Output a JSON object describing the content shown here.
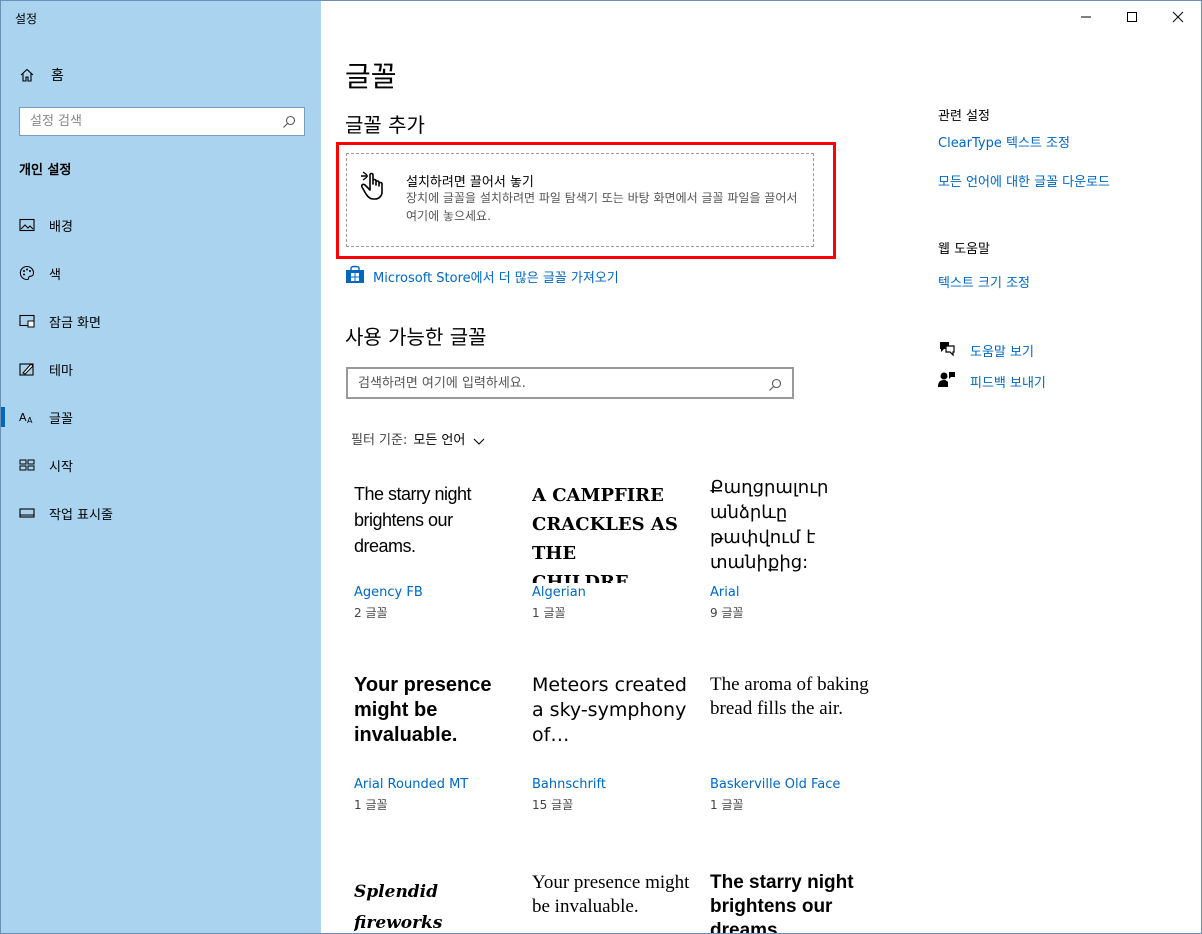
{
  "window": {
    "title": "설정"
  },
  "sidebar": {
    "home_label": "홈",
    "search_placeholder": "설정 검색",
    "section_title": "개인 설정",
    "items": [
      {
        "label": "배경",
        "icon": "image-icon"
      },
      {
        "label": "색",
        "icon": "palette-icon"
      },
      {
        "label": "잠금 화면",
        "icon": "lock-screen-icon"
      },
      {
        "label": "테마",
        "icon": "theme-icon"
      },
      {
        "label": "글꼴",
        "icon": "font-icon",
        "active": true
      },
      {
        "label": "시작",
        "icon": "start-icon"
      },
      {
        "label": "작업 표시줄",
        "icon": "taskbar-icon"
      }
    ]
  },
  "main": {
    "title": "글꼴",
    "add_heading": "글꼴 추가",
    "dropzone": {
      "title": "설치하려면 끌어서 놓기",
      "description": "장치에 글꼴을 설치하려면 파일 탐색기 또는 바탕 화면에서 글꼴 파일을 끌어서 여기에 놓으세요."
    },
    "store_link": "Microsoft Store에서 더 많은 글꼴 가져오기",
    "available_heading": "사용 가능한 글꼴",
    "font_search_placeholder": "검색하려면 여기에 입력하세요.",
    "filter_prefix": "필터 기준:",
    "filter_value": "모든 언어",
    "fonts": [
      {
        "sample": "The starry night brightens our dreams.",
        "name": "Agency FB",
        "count": "2 글꼴"
      },
      {
        "sample": "A CAMPFIRE CRACKLES AS THE CHILDRE…",
        "name": "Algerian",
        "count": "1 글꼴"
      },
      {
        "sample": "Քաղցրալուր անձրևը թափվում է տանիքից:",
        "name": "Arial",
        "count": "9 글꼴"
      },
      {
        "sample": "Your presence might be invaluable.",
        "name": "Arial Rounded MT",
        "count": "1 글꼴"
      },
      {
        "sample": "Meteors created a sky-symphony of…",
        "name": "Bahnschrift",
        "count": "15 글꼴"
      },
      {
        "sample": "The aroma of baking bread fills the air.",
        "name": "Baskerville Old Face",
        "count": "1 글꼴"
      },
      {
        "sample": "Splendid fireworks",
        "name": "",
        "count": ""
      },
      {
        "sample": "Your presence might be invaluable.",
        "name": "",
        "count": ""
      },
      {
        "sample": "The starry night brightens our dreams.",
        "name": "",
        "count": ""
      }
    ]
  },
  "right": {
    "related_heading": "관련 설정",
    "related_links": [
      "ClearType 텍스트 조정",
      "모든 언어에 대한 글꼴 다운로드"
    ],
    "web_help_heading": "웹 도움말",
    "web_help_link": "텍스트 크기 조정",
    "help_label": "도움말 보기",
    "feedback_label": "피드백 보내기"
  },
  "colors": {
    "sidebar_bg": "#a9d3ee",
    "accent": "#0067c0",
    "highlight_border": "#ff0000"
  }
}
